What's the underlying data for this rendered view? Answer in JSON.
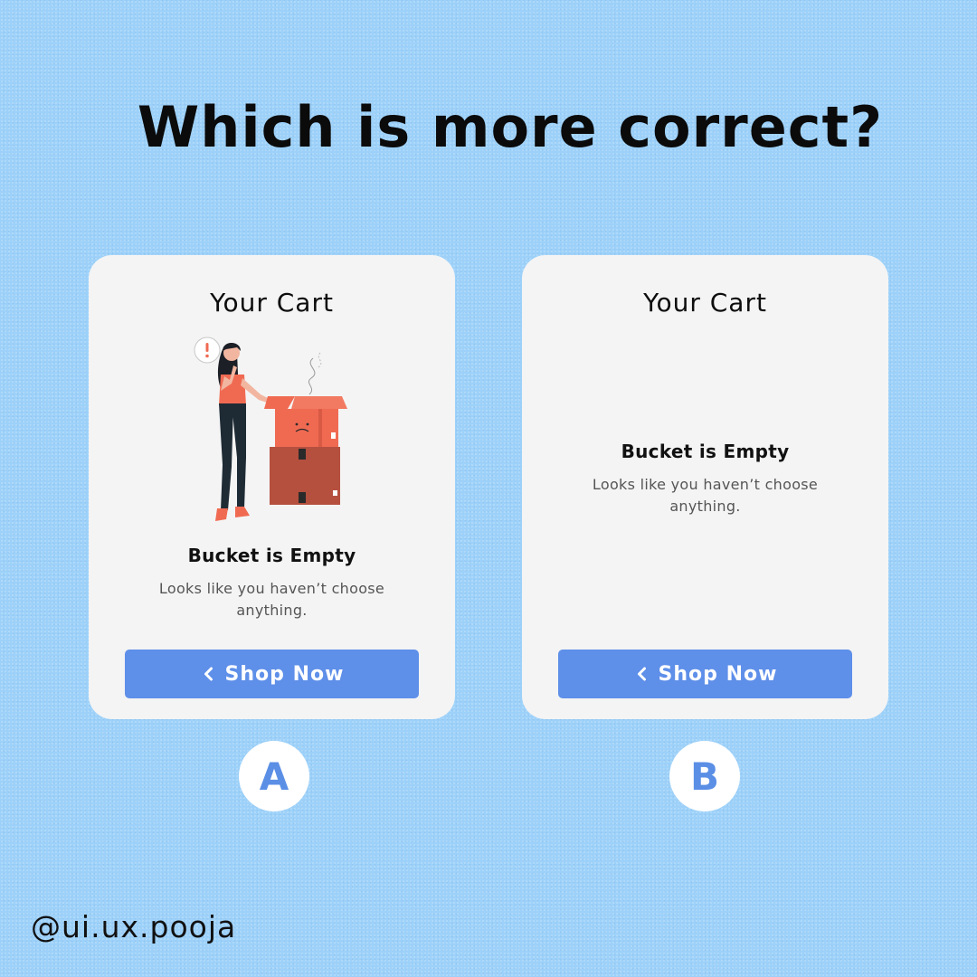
{
  "headline": "Which is more correct?",
  "options": [
    {
      "id": "A",
      "title": "Your Cart",
      "empty_title": "Bucket is Empty",
      "empty_message": "Looks like you haven’t choose anything.",
      "button_label": "Shop Now",
      "button_icon": "chevron-left-icon",
      "illustration": "woman-with-empty-sad-box-illustration",
      "badge": "A"
    },
    {
      "id": "B",
      "title": "Your Cart",
      "empty_title": "Bucket is Empty",
      "empty_message": "Looks like you haven’t choose anything.",
      "button_label": "Shop Now",
      "button_icon": "chevron-left-icon",
      "badge": "B"
    }
  ],
  "handle": "@ui.ux.pooja",
  "colors": {
    "background": "#9dd1f9",
    "card": "#f4f4f4",
    "button": "#5e8fe9",
    "badge_text": "#5b8fe6",
    "illustration_box": "#f06a52",
    "illustration_box_dark": "#b5503f"
  }
}
